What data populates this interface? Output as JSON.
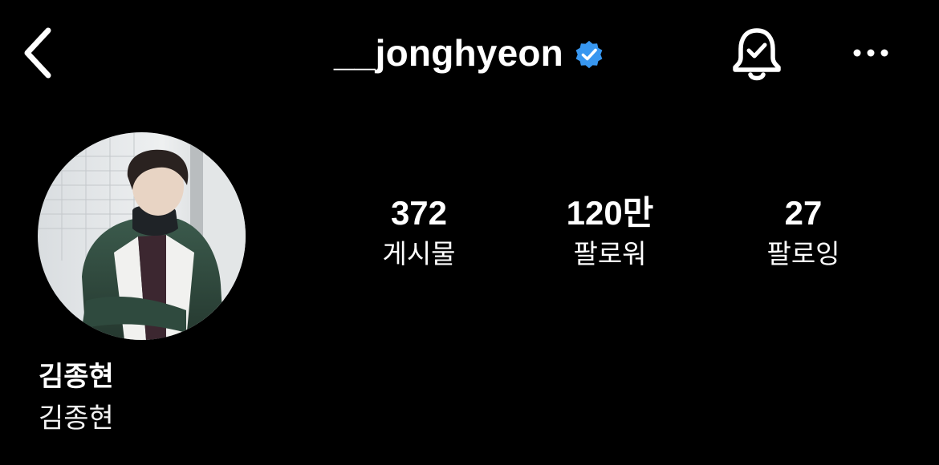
{
  "header": {
    "username": "__jonghyeon",
    "verified": true,
    "icons": {
      "back": "chevron-left-icon",
      "verified": "verified-badge-icon",
      "notifications": "bell-check-icon",
      "more": "more-horizontal-icon"
    }
  },
  "profile": {
    "avatar": "profile-photo",
    "stats": {
      "posts": {
        "value": "372",
        "label": "게시물"
      },
      "followers": {
        "value": "120만",
        "label": "팔로워"
      },
      "following": {
        "value": "27",
        "label": "팔로잉"
      }
    },
    "display_name": "김종현",
    "category_name": "김종현"
  },
  "colors": {
    "background": "#000000",
    "text": "#ffffff",
    "verified_blue": "#3897f0"
  }
}
